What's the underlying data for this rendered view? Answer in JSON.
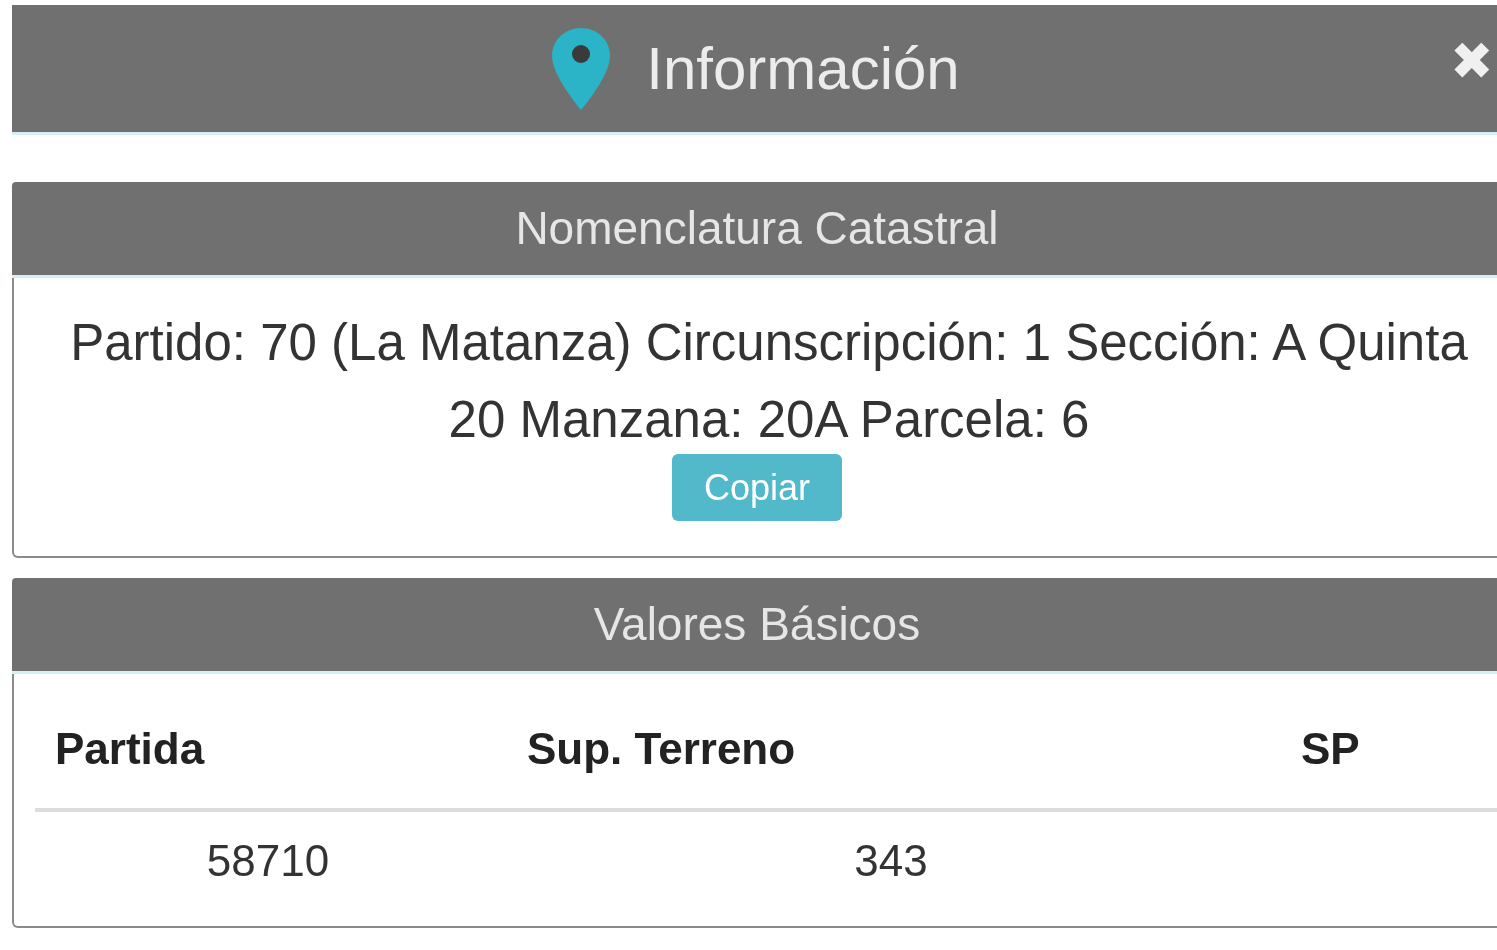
{
  "dialog": {
    "title": "Información",
    "close": "✖"
  },
  "nomenclatura": {
    "title": "Nomenclatura Catastral",
    "text": "Partido: 70 (La Matanza) Circunscripción: 1 Sección: A Quinta 20 Manzana: 20A Parcela: 6",
    "button": "Copiar"
  },
  "valores": {
    "title": "Valores Básicos",
    "table": {
      "columns": [
        "Partida",
        "Sup. Terreno",
        "SP"
      ],
      "rows": [
        [
          "58710",
          "343",
          ""
        ]
      ]
    }
  }
}
